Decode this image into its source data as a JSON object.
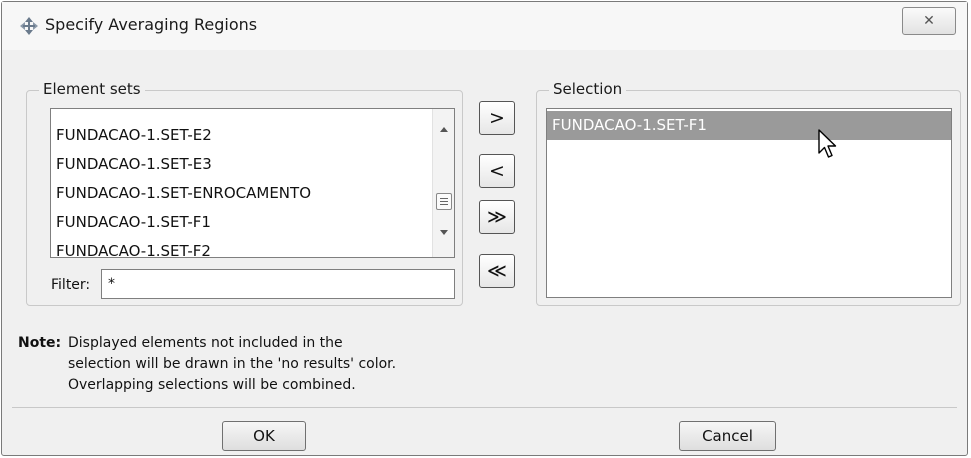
{
  "window": {
    "title": "Specify Averaging Regions",
    "title_icon": "move-crosshair-icon",
    "close_glyph": "✕"
  },
  "element_sets": {
    "label": "Element sets",
    "items": [
      "FUNDACAO-1.SET-E2",
      "FUNDACAO-1.SET-E3",
      "FUNDACAO-1.SET-ENROCAMENTO",
      "FUNDACAO-1.SET-F1",
      "FUNDACAO-1.SET-F2"
    ],
    "filter_label": "Filter:",
    "filter_value": "*"
  },
  "move_buttons": {
    "add": ">",
    "remove": "<",
    "add_all": "≫",
    "remove_all": "≪"
  },
  "selection": {
    "label": "Selection",
    "items": [
      "FUNDACAO-1.SET-F1"
    ],
    "selected_item": "FUNDACAO-1.SET-F1"
  },
  "note": {
    "label": "Note:",
    "lines": [
      "Displayed elements not included in the",
      "selection will be drawn in the 'no results' color.",
      "Overlapping selections will be combined."
    ]
  },
  "buttons": {
    "ok": "OK",
    "cancel": "Cancel"
  },
  "colors": {
    "selection_highlight": "#9a9a9a",
    "dialog_bg": "#f0f0f0"
  }
}
